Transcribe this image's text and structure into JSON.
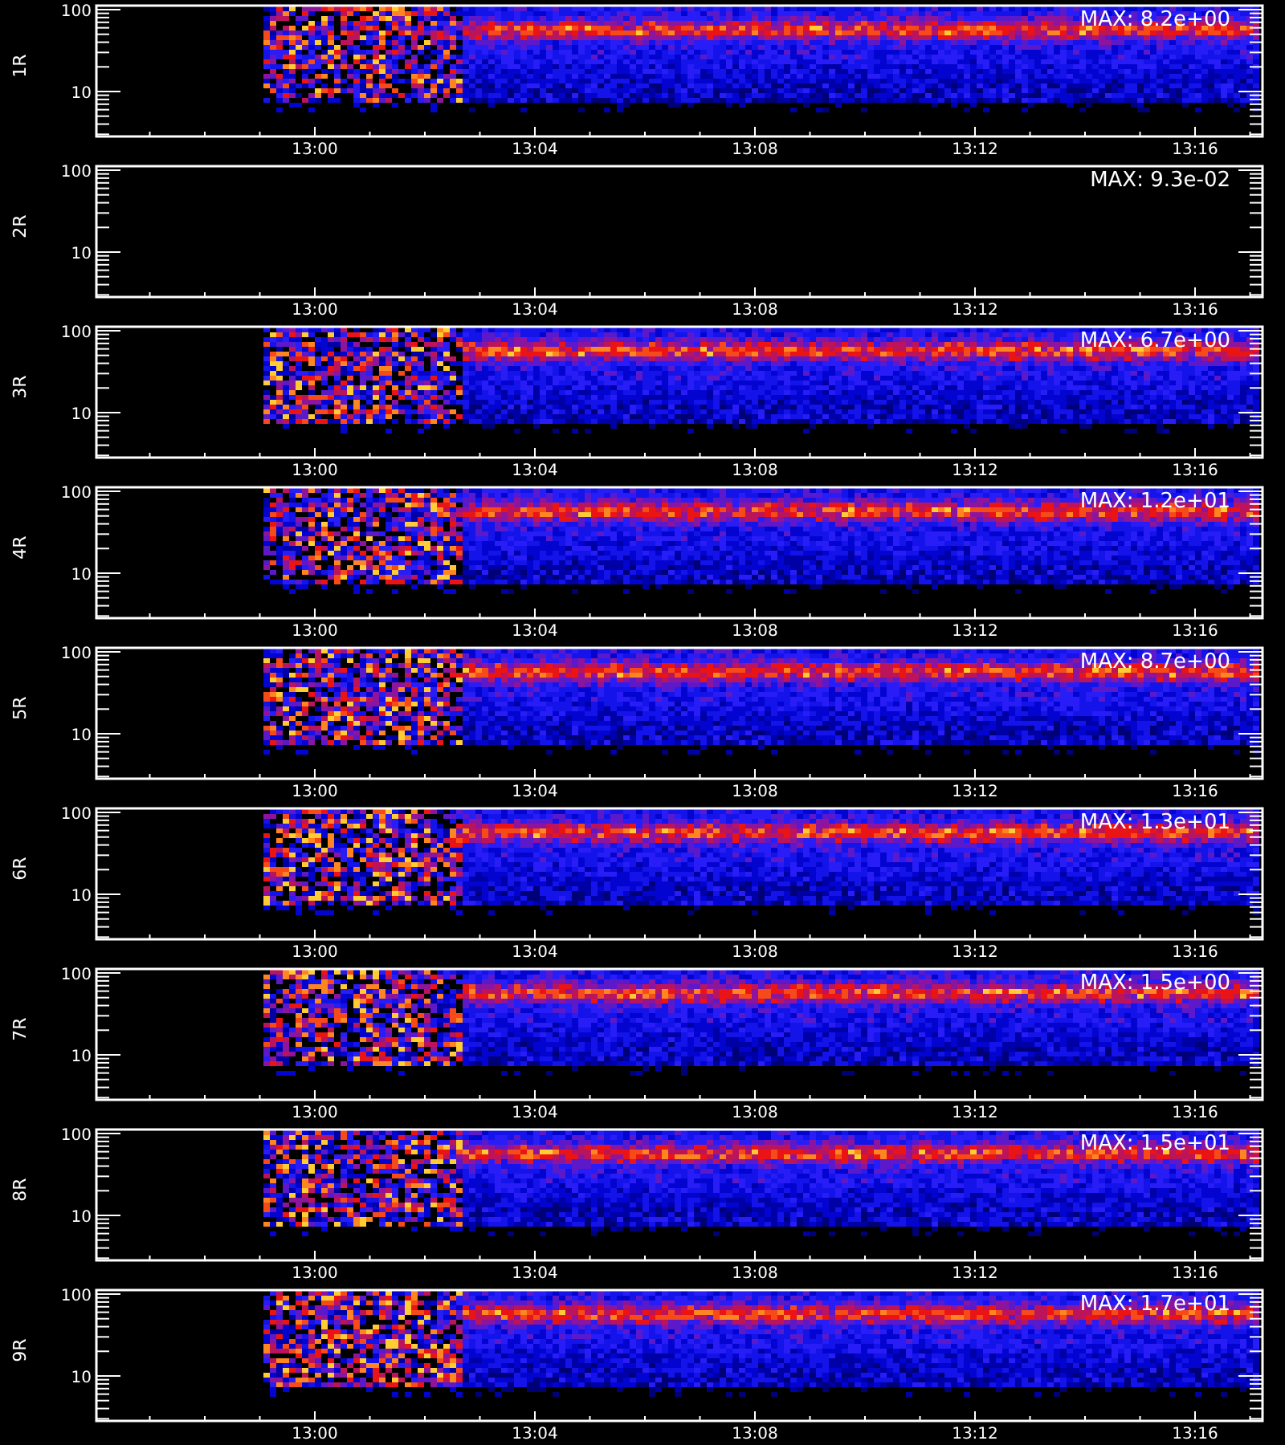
{
  "panels": [
    {
      "label": "1R",
      "max_label": "MAX: 8.2e+00",
      "empty": false,
      "y_ticks": [
        "100",
        "10"
      ],
      "x_ticks": [
        "13:00",
        "13:04",
        "13:08",
        "13:12",
        "13:16"
      ]
    },
    {
      "label": "2R",
      "max_label": "MAX: 9.3e-02",
      "empty": true,
      "y_ticks": [
        "100",
        "10"
      ],
      "x_ticks": [
        "13:00",
        "13:04",
        "13:08",
        "13:12",
        "13:16"
      ]
    },
    {
      "label": "3R",
      "max_label": "MAX: 6.7e+00",
      "empty": false,
      "y_ticks": [
        "100",
        "10"
      ],
      "x_ticks": [
        "13:00",
        "13:04",
        "13:08",
        "13:12",
        "13:16"
      ]
    },
    {
      "label": "4R",
      "max_label": "MAX: 1.2e+01",
      "empty": false,
      "y_ticks": [
        "100",
        "10"
      ],
      "x_ticks": [
        "13:00",
        "13:04",
        "13:08",
        "13:12",
        "13:16"
      ]
    },
    {
      "label": "5R",
      "max_label": "MAX: 8.7e+00",
      "empty": false,
      "y_ticks": [
        "100",
        "10"
      ],
      "x_ticks": [
        "13:00",
        "13:04",
        "13:08",
        "13:12",
        "13:16"
      ]
    },
    {
      "label": "6R",
      "max_label": "MAX: 1.3e+01",
      "empty": false,
      "y_ticks": [
        "100",
        "10"
      ],
      "x_ticks": [
        "13:00",
        "13:04",
        "13:08",
        "13:12",
        "13:16"
      ]
    },
    {
      "label": "7R",
      "max_label": "MAX: 1.5e+00",
      "empty": false,
      "y_ticks": [
        "100",
        "10"
      ],
      "x_ticks": [
        "13:00",
        "13:04",
        "13:08",
        "13:12",
        "13:16"
      ]
    },
    {
      "label": "8R",
      "max_label": "MAX: 1.5e+01",
      "empty": false,
      "y_ticks": [
        "100",
        "10"
      ],
      "x_ticks": [
        "13:00",
        "13:04",
        "13:08",
        "13:12",
        "13:16"
      ]
    },
    {
      "label": "9R",
      "max_label": "MAX: 1.7e+01",
      "empty": false,
      "y_ticks": [
        "100",
        "10"
      ],
      "x_ticks": [
        "13:00",
        "13:04",
        "13:08",
        "13:12",
        "13:16"
      ]
    }
  ]
}
